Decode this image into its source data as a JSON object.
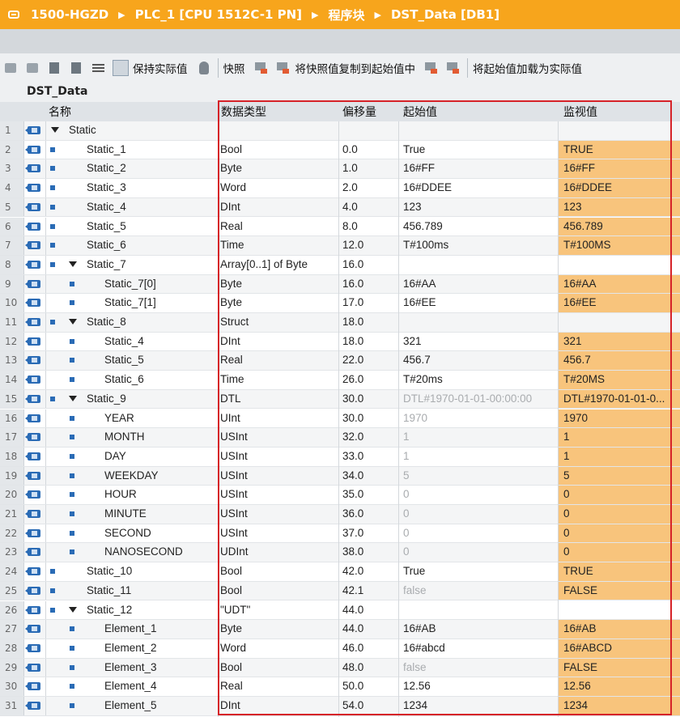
{
  "breadcrumb": [
    "1500-HGZD",
    "PLC_1 [CPU 1512C-1 PN]",
    "程序块",
    "DST_Data [DB1]"
  ],
  "toolbar": {
    "keep_actual": "保持实际值",
    "snapshot": "快照",
    "copy_snapshot": "将快照值复制到起始值中",
    "load_start": "将起始值加载为实际值"
  },
  "object_title": "DST_Data",
  "columns": {
    "name": "名称",
    "type": "数据类型",
    "offset": "偏移量",
    "start": "起始值",
    "monitor": "监视值"
  },
  "rows": [
    {
      "n": "1",
      "name": "Static",
      "type": "",
      "offset": "",
      "start": "",
      "monitor": ""
    },
    {
      "n": "2",
      "name": "Static_1",
      "type": "Bool",
      "offset": "0.0",
      "start": "True",
      "monitor": "TRUE"
    },
    {
      "n": "3",
      "name": "Static_2",
      "type": "Byte",
      "offset": "1.0",
      "start": "16#FF",
      "monitor": "16#FF"
    },
    {
      "n": "4",
      "name": "Static_3",
      "type": "Word",
      "offset": "2.0",
      "start": "16#DDEE",
      "monitor": "16#DDEE"
    },
    {
      "n": "5",
      "name": "Static_4",
      "type": "DInt",
      "offset": "4.0",
      "start": "123",
      "monitor": "123"
    },
    {
      "n": "6",
      "name": "Static_5",
      "type": "Real",
      "offset": "8.0",
      "start": "456.789",
      "monitor": "456.789"
    },
    {
      "n": "7",
      "name": "Static_6",
      "type": "Time",
      "offset": "12.0",
      "start": "T#100ms",
      "monitor": "T#100MS"
    },
    {
      "n": "8",
      "name": "Static_7",
      "type": "Array[0..1] of Byte",
      "offset": "16.0",
      "start": "",
      "monitor": ""
    },
    {
      "n": "9",
      "name": "Static_7[0]",
      "type": "Byte",
      "offset": "16.0",
      "start": "16#AA",
      "monitor": "16#AA"
    },
    {
      "n": "10",
      "name": "Static_7[1]",
      "type": "Byte",
      "offset": "17.0",
      "start": "16#EE",
      "monitor": "16#EE"
    },
    {
      "n": "11",
      "name": "Static_8",
      "type": "Struct",
      "offset": "18.0",
      "start": "",
      "monitor": ""
    },
    {
      "n": "12",
      "name": "Static_4",
      "type": "DInt",
      "offset": "18.0",
      "start": "321",
      "monitor": "321"
    },
    {
      "n": "13",
      "name": "Static_5",
      "type": "Real",
      "offset": "22.0",
      "start": "456.7",
      "monitor": "456.7"
    },
    {
      "n": "14",
      "name": "Static_6",
      "type": "Time",
      "offset": "26.0",
      "start": "T#20ms",
      "monitor": "T#20MS"
    },
    {
      "n": "15",
      "name": "Static_9",
      "type": "DTL",
      "offset": "30.0",
      "start": "DTL#1970-01-01-00:00:00",
      "monitor": "DTL#1970-01-01-0..."
    },
    {
      "n": "16",
      "name": "YEAR",
      "type": "UInt",
      "offset": "30.0",
      "start": "1970",
      "monitor": "1970"
    },
    {
      "n": "17",
      "name": "MONTH",
      "type": "USInt",
      "offset": "32.0",
      "start": "1",
      "monitor": "1"
    },
    {
      "n": "18",
      "name": "DAY",
      "type": "USInt",
      "offset": "33.0",
      "start": "1",
      "monitor": "1"
    },
    {
      "n": "19",
      "name": "WEEKDAY",
      "type": "USInt",
      "offset": "34.0",
      "start": "5",
      "monitor": "5"
    },
    {
      "n": "20",
      "name": "HOUR",
      "type": "USInt",
      "offset": "35.0",
      "start": "0",
      "monitor": "0"
    },
    {
      "n": "21",
      "name": "MINUTE",
      "type": "USInt",
      "offset": "36.0",
      "start": "0",
      "monitor": "0"
    },
    {
      "n": "22",
      "name": "SECOND",
      "type": "USInt",
      "offset": "37.0",
      "start": "0",
      "monitor": "0"
    },
    {
      "n": "23",
      "name": "NANOSECOND",
      "type": "UDInt",
      "offset": "38.0",
      "start": "0",
      "monitor": "0"
    },
    {
      "n": "24",
      "name": "Static_10",
      "type": "Bool",
      "offset": "42.0",
      "start": "True",
      "monitor": "TRUE"
    },
    {
      "n": "25",
      "name": "Static_11",
      "type": "Bool",
      "offset": "42.1",
      "start": "false",
      "monitor": "FALSE"
    },
    {
      "n": "26",
      "name": "Static_12",
      "type": "\"UDT\"",
      "offset": "44.0",
      "start": "",
      "monitor": ""
    },
    {
      "n": "27",
      "name": "Element_1",
      "type": "Byte",
      "offset": "44.0",
      "start": "16#AB",
      "monitor": "16#AB"
    },
    {
      "n": "28",
      "name": "Element_2",
      "type": "Word",
      "offset": "46.0",
      "start": "16#abcd",
      "monitor": "16#ABCD"
    },
    {
      "n": "29",
      "name": "Element_3",
      "type": "Bool",
      "offset": "48.0",
      "start": "false",
      "monitor": "FALSE"
    },
    {
      "n": "30",
      "name": "Element_4",
      "type": "Real",
      "offset": "50.0",
      "start": "12.56",
      "monitor": "12.56"
    },
    {
      "n": "31",
      "name": "Element_5",
      "type": "DInt",
      "offset": "54.0",
      "start": "1234",
      "monitor": "1234"
    }
  ]
}
